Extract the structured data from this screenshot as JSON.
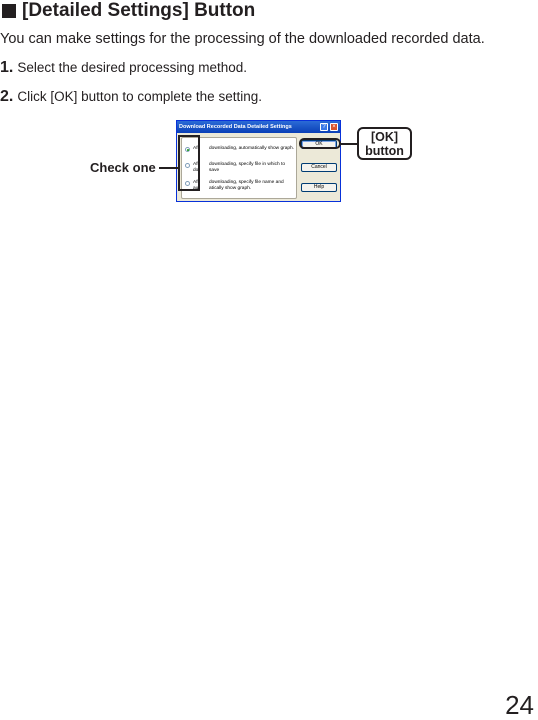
{
  "heading": {
    "text": "[Detailed Settings] Button"
  },
  "intro": "You can make settings for the processing of the downloaded recorded data.",
  "steps": [
    {
      "num": "1.",
      "text": "Select the desired processing method."
    },
    {
      "num": "2.",
      "text": "Click [OK] button to complete the setting."
    }
  ],
  "dialog": {
    "title": "Download Recorded Data Detailed Settings",
    "title_buttons": [
      "?",
      "×"
    ],
    "options": [
      {
        "label": "Aft",
        "desc": "downloading, automatically show graph.",
        "selected": true
      },
      {
        "label": "Aft\ndo",
        "desc": "downloading, specify file in which to save",
        "selected": false
      },
      {
        "label": "Aft\nau",
        "desc": "downloading, specify file name and\natically show graph.",
        "selected": false
      }
    ],
    "buttons": {
      "ok": "OK",
      "cancel": "Cancel",
      "help": "Help"
    }
  },
  "callouts": {
    "check_one": "Check one",
    "ok_button": "[OK]\nbutton"
  },
  "page_number": "24"
}
